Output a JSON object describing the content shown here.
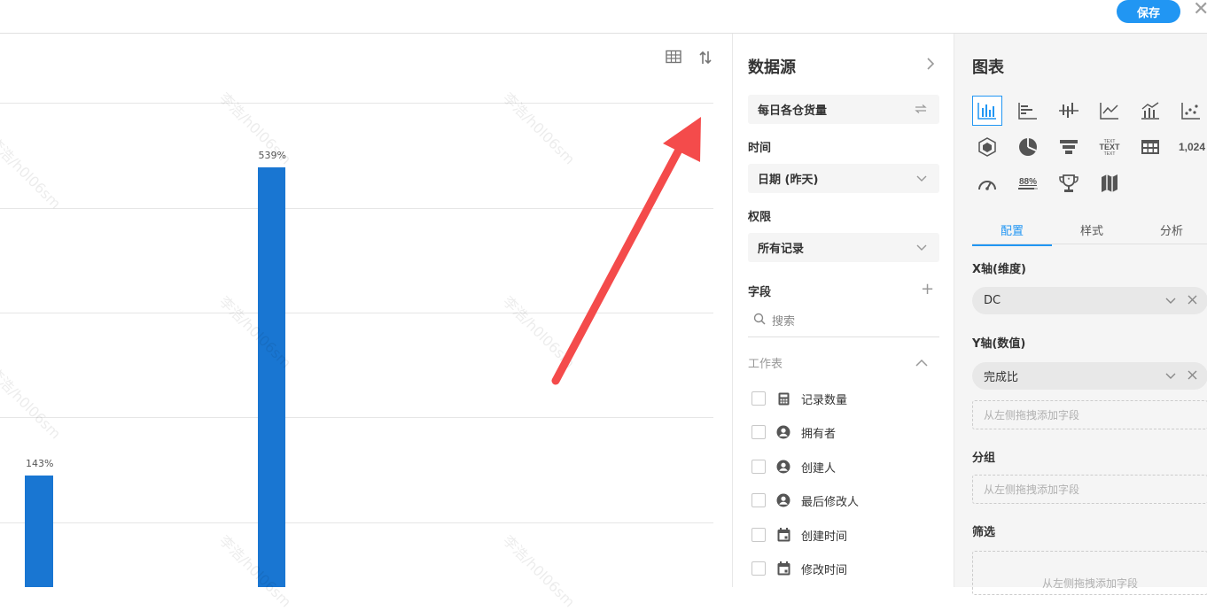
{
  "header": {
    "save_label": "保存",
    "close_glyph": "✕"
  },
  "chart_data": {
    "type": "bar",
    "categories": [
      "",
      ""
    ],
    "values": [
      143,
      539
    ],
    "value_labels": [
      "143%",
      "539%"
    ],
    "title": "",
    "xlabel": "",
    "ylabel": "",
    "grid": true
  },
  "watermark": {
    "text": "李浩/h0l06sm"
  },
  "datasource": {
    "title": "数据源",
    "worksheet_name": "每日各仓货量",
    "time_label": "时间",
    "time_value": "日期 (昨天)",
    "permission_label": "权限",
    "permission_value": "所有记录",
    "fields_label": "字段",
    "search_placeholder": "搜索",
    "group_label": "工作表",
    "fields": [
      {
        "label": "记录数量",
        "icon": "calculator-icon"
      },
      {
        "label": "拥有者",
        "icon": "user-circle-icon"
      },
      {
        "label": "创建人",
        "icon": "user-circle-icon"
      },
      {
        "label": "最后修改人",
        "icon": "user-circle-icon"
      },
      {
        "label": "创建时间",
        "icon": "calendar-icon"
      },
      {
        "label": "修改时间",
        "icon": "calendar-icon"
      }
    ]
  },
  "config": {
    "title": "图表",
    "chart_types": [
      "bar-chart-icon",
      "horizontal-bar-icon",
      "bidirectional-bar-icon",
      "line-chart-icon",
      "dual-axis-icon",
      "scatter-icon",
      "radar-icon",
      "pie-chart-icon",
      "funnel-icon",
      "word-cloud-icon",
      "pivot-table-icon",
      "number-icon",
      "gauge-icon",
      "progress-icon",
      "ranking-icon",
      "map-icon"
    ],
    "wordcloud_text": "TEXT",
    "number_text": "1,024",
    "progress_text": "88%",
    "tabs": [
      "配置",
      "样式",
      "分析"
    ],
    "x_axis_label": "X轴(维度)",
    "x_axis_value": "DC",
    "y_axis_label": "Y轴(数值)",
    "y_axis_value": "完成比",
    "drop_hint": "从左侧拖拽添加字段",
    "group_label": "分组",
    "filter_label": "筛选"
  },
  "colors": {
    "accent": "#2196f3",
    "bar": "#1976d2",
    "arrow": "#f44b4b"
  }
}
